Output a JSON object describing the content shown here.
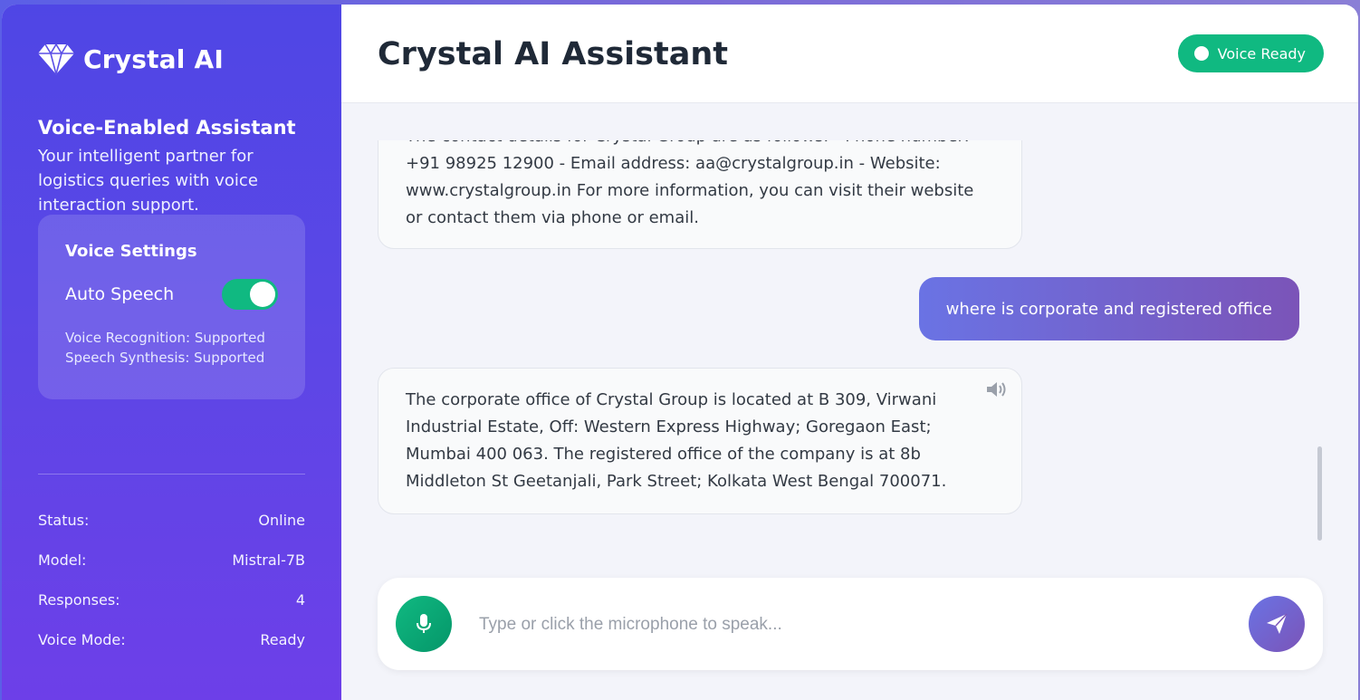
{
  "brand": {
    "name": "Crystal AI",
    "icon": "gem-icon"
  },
  "sidebar": {
    "title": "Voice-Enabled Assistant",
    "description": "Your intelligent partner for logistics queries with voice interaction support.",
    "voice_settings": {
      "title": "Voice Settings",
      "auto_speech_label": "Auto Speech",
      "auto_speech_on": true,
      "recognition": "Voice Recognition: Supported",
      "synthesis": "Speech Synthesis: Supported"
    },
    "stats": [
      {
        "label": "Status:",
        "value": "Online"
      },
      {
        "label": "Model:",
        "value": "Mistral-7B"
      },
      {
        "label": "Responses:",
        "value": "4"
      },
      {
        "label": "Voice Mode:",
        "value": "Ready"
      }
    ]
  },
  "header": {
    "title": "Crystal AI Assistant",
    "badge": "Voice Ready"
  },
  "messages": [
    {
      "role": "assistant",
      "text": "The contact details for Crystal Group are as follows: - Phone number: +91 98925 12900 - Email address: aa@crystalgroup.in - Website: www.crystalgroup.in For more information, you can visit their website or contact them via phone or email."
    },
    {
      "role": "user",
      "text": "where is corporate and registered office"
    },
    {
      "role": "assistant",
      "text": "The corporate office of Crystal Group is located at B 309, Virwani Industrial Estate, Off: Western Express Highway; Goregaon East; Mumbai 400 063. The registered office of the company is at 8b Middleton St Geetanjali, Park Street; Kolkata West Bengal 700071."
    }
  ],
  "composer": {
    "placeholder": "Type or click the microphone to speak...",
    "value": ""
  },
  "colors": {
    "accent": "#4f46e5",
    "success": "#10b981",
    "user_bubble": "#7b54b8"
  }
}
